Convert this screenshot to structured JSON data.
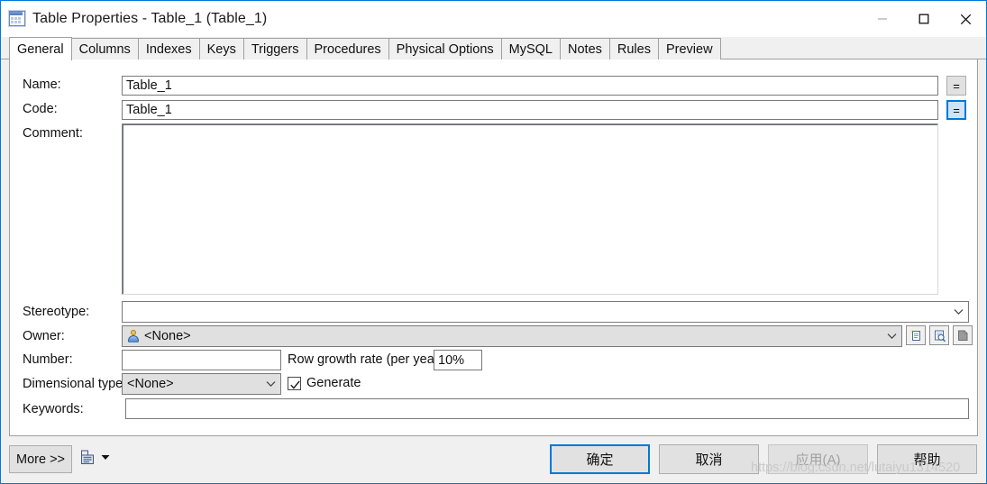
{
  "window": {
    "title": "Table Properties - Table_1 (Table_1)",
    "icon": "table-icon",
    "controls": {
      "minimize": "minimize-icon",
      "maximize": "maximize-icon",
      "close": "close-icon"
    }
  },
  "tabs": [
    {
      "label": "General",
      "selected": true
    },
    {
      "label": "Columns",
      "selected": false
    },
    {
      "label": "Indexes",
      "selected": false
    },
    {
      "label": "Keys",
      "selected": false
    },
    {
      "label": "Triggers",
      "selected": false
    },
    {
      "label": "Procedures",
      "selected": false
    },
    {
      "label": "Physical Options",
      "selected": false
    },
    {
      "label": "MySQL",
      "selected": false
    },
    {
      "label": "Notes",
      "selected": false
    },
    {
      "label": "Rules",
      "selected": false
    },
    {
      "label": "Preview",
      "selected": false
    }
  ],
  "form": {
    "name": {
      "label": "Name:",
      "value": "Table_1",
      "placeholder": "",
      "equals_button": "="
    },
    "code": {
      "label": "Code:",
      "value": "Table_1",
      "placeholder": "",
      "equals_button": "="
    },
    "comment": {
      "label": "Comment:",
      "value": "",
      "placeholder": ""
    },
    "stereotype": {
      "label": "Stereotype:",
      "value": "",
      "placeholder": ""
    },
    "owner": {
      "label": "Owner:",
      "value": "<None>",
      "buttons": [
        "create-icon",
        "properties-icon",
        "delete-icon"
      ]
    },
    "number": {
      "label": "Number:",
      "value": "",
      "placeholder": ""
    },
    "row_growth_rate": {
      "label": "Row growth rate (per year):",
      "value": "10%"
    },
    "dimensional_type": {
      "label": "Dimensional type:",
      "value": "<None>"
    },
    "generate": {
      "label": "Generate",
      "checked": true
    },
    "keywords": {
      "label": "Keywords:",
      "value": "",
      "placeholder": ""
    }
  },
  "footer": {
    "more": "More >>",
    "report_icon": "report-icon",
    "report_dropdown": "chevron-down-icon",
    "ok": "确定",
    "cancel": "取消",
    "apply": "应用(A)",
    "help": "帮助"
  },
  "watermark": "https://blog.csdn.net/lutaiyu1314520",
  "colors": {
    "accent": "#0078d7",
    "window_bg": "#f0f0f0",
    "panel_bg": "#ffffff",
    "border": "#a0a0a0",
    "disabled_text": "#a0a0a0"
  }
}
